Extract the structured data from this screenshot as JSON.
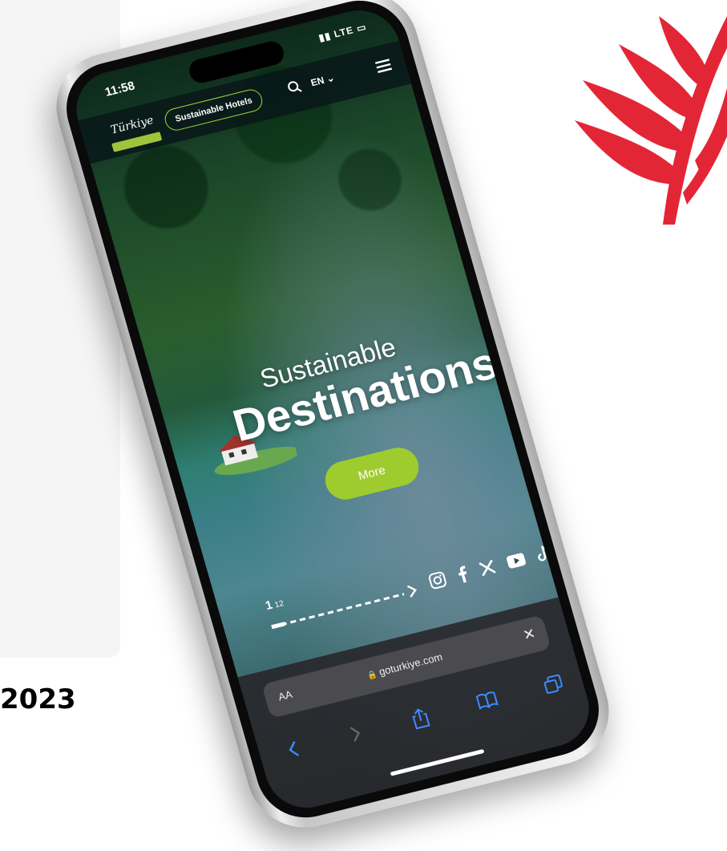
{
  "year_text": "2023",
  "status": {
    "time": "11:58",
    "network": "LTE"
  },
  "nav": {
    "logo_text": "Türkiye",
    "hotels_button": "Sustainable Hotels",
    "language": "EN"
  },
  "hero": {
    "line1": "Sustainable",
    "line2": "Destinations",
    "button": "More"
  },
  "slider": {
    "current": "1",
    "total": "12",
    "progress": 0.1
  },
  "social_icons": [
    "instagram-icon",
    "facebook-icon",
    "x-icon",
    "youtube-icon",
    "tiktok-icon"
  ],
  "browser": {
    "text_size": "AA",
    "url": "goturkiye.com"
  },
  "colors": {
    "accent_green": "#9ecc2f",
    "leaf_red": "#e32636"
  }
}
